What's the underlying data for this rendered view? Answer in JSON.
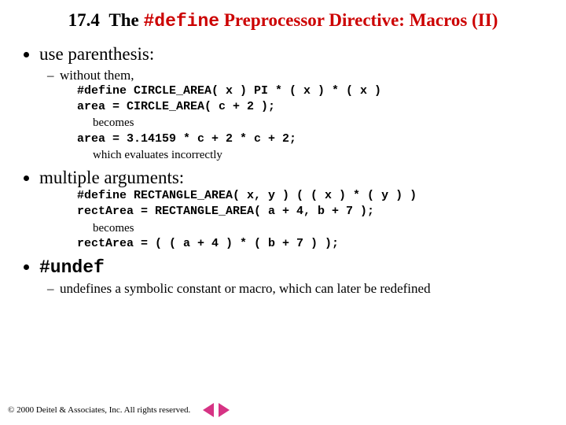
{
  "title": {
    "section": "17.4",
    "plain1": "The ",
    "mono": "#define",
    "plain2": " Preprocessor Directive: Macros (II)"
  },
  "bullet1": {
    "label": "use parenthesis:",
    "sub": "without them,",
    "code1": "#define CIRCLE_AREA( x )  PI * ( x ) * ( x )",
    "code2": "area = CIRCLE_AREA( c + 2 );",
    "becomes": "becomes",
    "code3": "area = 3.14159 * c + 2 * c + 2;",
    "note": "which evaluates incorrectly"
  },
  "bullet2": {
    "label": "multiple arguments:",
    "code1": "#define RECTANGLE_AREA( x, y )  ( ( x ) * ( y ) )",
    "code2": "rectArea = RECTANGLE_AREA( a + 4, b + 7 );",
    "becomes": "becomes",
    "code3": "rectArea = ( ( a + 4 ) * ( b + 7 ) );"
  },
  "bullet3": {
    "label": "#undef",
    "sub": "undefines a symbolic constant or macro, which can later be redefined"
  },
  "footer": {
    "copyright": "© 2000 Deitel & Associates, Inc.  All rights reserved."
  }
}
